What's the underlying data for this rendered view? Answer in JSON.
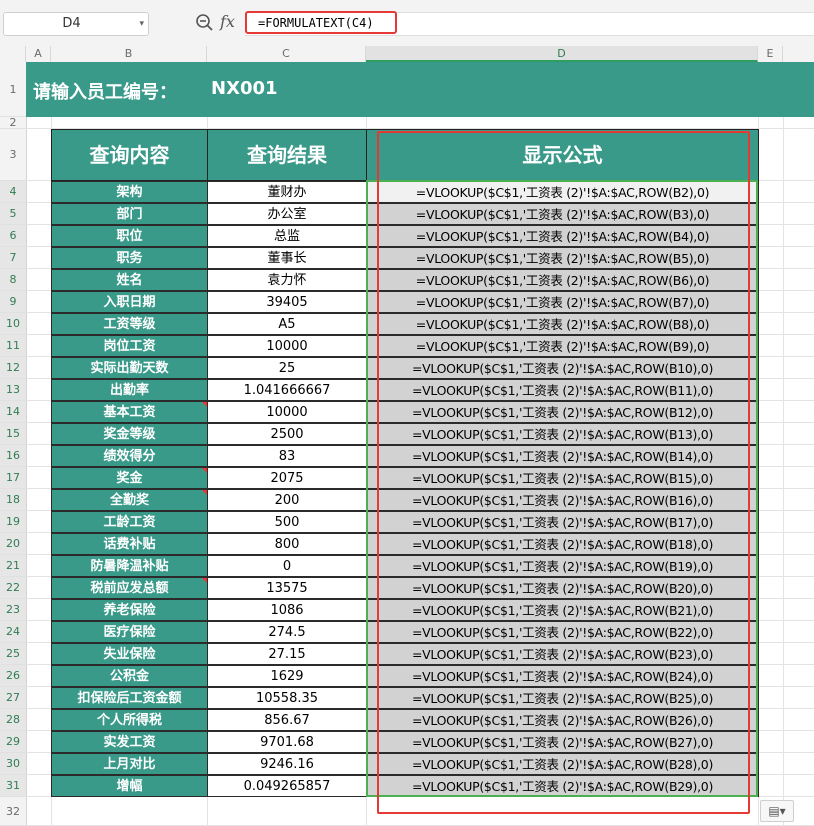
{
  "formula_bar": {
    "name_box": "D4",
    "fx_label": "fx",
    "formula": "=FORMULATEXT(C4)"
  },
  "columns": [
    "A",
    "B",
    "C",
    "D",
    "E"
  ],
  "rows": [
    "1",
    "2",
    "3",
    "4",
    "5",
    "6",
    "7",
    "8",
    "9",
    "10",
    "11",
    "12",
    "13",
    "14",
    "15",
    "16",
    "17",
    "18",
    "19",
    "20",
    "21",
    "22",
    "23",
    "24",
    "25",
    "26",
    "27",
    "28",
    "29",
    "30",
    "31",
    "32"
  ],
  "title": {
    "label": "请输入员工编号：",
    "value": "NX001"
  },
  "table": {
    "headers": [
      "查询内容",
      "查询结果",
      "显示公式"
    ],
    "rows": [
      {
        "item": "架构",
        "result": "董财办",
        "formula": "=VLOOKUP($C$1,'工资表 (2)'!$A:$AC,ROW(B2),0)"
      },
      {
        "item": "部门",
        "result": "办公室",
        "formula": "=VLOOKUP($C$1,'工资表 (2)'!$A:$AC,ROW(B3),0)"
      },
      {
        "item": "职位",
        "result": "总监",
        "formula": "=VLOOKUP($C$1,'工资表 (2)'!$A:$AC,ROW(B4),0)"
      },
      {
        "item": "职务",
        "result": "董事长",
        "formula": "=VLOOKUP($C$1,'工资表 (2)'!$A:$AC,ROW(B5),0)"
      },
      {
        "item": "姓名",
        "result": "袁力怀",
        "formula": "=VLOOKUP($C$1,'工资表 (2)'!$A:$AC,ROW(B6),0)"
      },
      {
        "item": "入职日期",
        "result": "39405",
        "formula": "=VLOOKUP($C$1,'工资表 (2)'!$A:$AC,ROW(B7),0)"
      },
      {
        "item": "工资等级",
        "result": "A5",
        "formula": "=VLOOKUP($C$1,'工资表 (2)'!$A:$AC,ROW(B8),0)"
      },
      {
        "item": "岗位工资",
        "result": "10000",
        "formula": "=VLOOKUP($C$1,'工资表 (2)'!$A:$AC,ROW(B9),0)"
      },
      {
        "item": "实际出勤天数",
        "result": "25",
        "formula": "=VLOOKUP($C$1,'工资表 (2)'!$A:$AC,ROW(B10),0)"
      },
      {
        "item": "出勤率",
        "result": "1.041666667",
        "formula": "=VLOOKUP($C$1,'工资表 (2)'!$A:$AC,ROW(B11),0)"
      },
      {
        "item": "基本工资",
        "result": "10000",
        "formula": "=VLOOKUP($C$1,'工资表 (2)'!$A:$AC,ROW(B12),0)"
      },
      {
        "item": "奖金等级",
        "result": "2500",
        "formula": "=VLOOKUP($C$1,'工资表 (2)'!$A:$AC,ROW(B13),0)"
      },
      {
        "item": "绩效得分",
        "result": "83",
        "formula": "=VLOOKUP($C$1,'工资表 (2)'!$A:$AC,ROW(B14),0)"
      },
      {
        "item": "奖金",
        "result": "2075",
        "formula": "=VLOOKUP($C$1,'工资表 (2)'!$A:$AC,ROW(B15),0)"
      },
      {
        "item": "全勤奖",
        "result": "200",
        "formula": "=VLOOKUP($C$1,'工资表 (2)'!$A:$AC,ROW(B16),0)"
      },
      {
        "item": "工龄工资",
        "result": "500",
        "formula": "=VLOOKUP($C$1,'工资表 (2)'!$A:$AC,ROW(B17),0)"
      },
      {
        "item": "话费补贴",
        "result": "800",
        "formula": "=VLOOKUP($C$1,'工资表 (2)'!$A:$AC,ROW(B18),0)"
      },
      {
        "item": "防暑降温补贴",
        "result": "0",
        "formula": "=VLOOKUP($C$1,'工资表 (2)'!$A:$AC,ROW(B19),0)"
      },
      {
        "item": "税前应发总额",
        "result": "13575",
        "formula": "=VLOOKUP($C$1,'工资表 (2)'!$A:$AC,ROW(B20),0)"
      },
      {
        "item": "养老保险",
        "result": "1086",
        "formula": "=VLOOKUP($C$1,'工资表 (2)'!$A:$AC,ROW(B21),0)"
      },
      {
        "item": "医疗保险",
        "result": "274.5",
        "formula": "=VLOOKUP($C$1,'工资表 (2)'!$A:$AC,ROW(B22),0)"
      },
      {
        "item": "失业保险",
        "result": "27.15",
        "formula": "=VLOOKUP($C$1,'工资表 (2)'!$A:$AC,ROW(B23),0)"
      },
      {
        "item": "公积金",
        "result": "1629",
        "formula": "=VLOOKUP($C$1,'工资表 (2)'!$A:$AC,ROW(B24),0)"
      },
      {
        "item": "扣保险后工资金额",
        "result": "10558.35",
        "formula": "=VLOOKUP($C$1,'工资表 (2)'!$A:$AC,ROW(B25),0)"
      },
      {
        "item": "个人所得税",
        "result": "856.67",
        "formula": "=VLOOKUP($C$1,'工资表 (2)'!$A:$AC,ROW(B26),0)"
      },
      {
        "item": "实发工资",
        "result": "9701.68",
        "formula": "=VLOOKUP($C$1,'工资表 (2)'!$A:$AC,ROW(B27),0)"
      },
      {
        "item": "上月对比",
        "result": "9246.16",
        "formula": "=VLOOKUP($C$1,'工资表 (2)'!$A:$AC,ROW(B28),0)"
      },
      {
        "item": "增幅",
        "result": "0.049265857",
        "formula": "=VLOOKUP($C$1,'工资表 (2)'!$A:$AC,ROW(B29),0)"
      }
    ]
  },
  "colors": {
    "teal_header": "#3a9a8a",
    "highlight_red": "#e53935",
    "selection_green": "#4caf50",
    "formula_cell_gray": "#d2d2d2"
  }
}
